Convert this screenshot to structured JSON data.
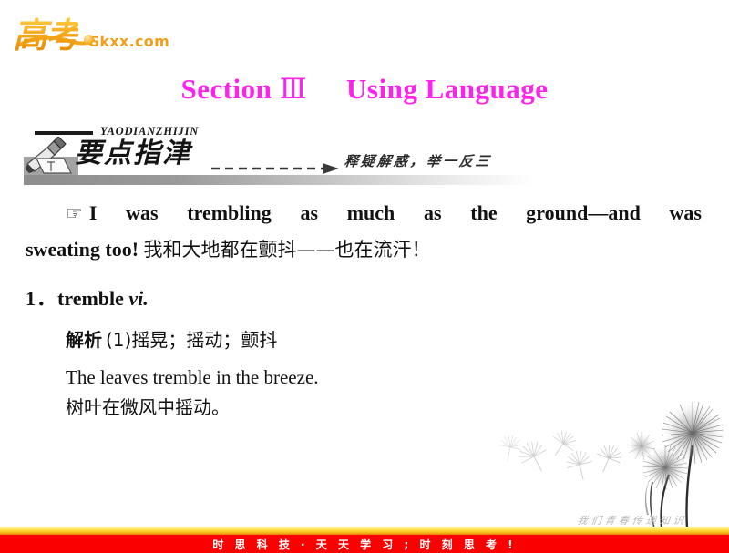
{
  "logo": {
    "cn": "高考",
    "site": "Gkxx.com",
    "color": "#f0a01a"
  },
  "title": {
    "prefix": "Section",
    "roman": "Ⅲ",
    "suffix": "Using Language",
    "color": "#ff22ee"
  },
  "banner": {
    "pinyin": "YAODIANZHIJIN",
    "heading": "要点指津",
    "tagline": "释疑解惑，举一反三",
    "icon": "pen-ink-icon"
  },
  "content": {
    "hand_icon": "☞",
    "quote_en_line1": "I was trembling as much as the ground—and was",
    "quote_en_line2": "sweating too!",
    "quote_cn": "我和大地都在颤抖——也在流汗！",
    "entry_number": "1．",
    "entry_word": "tremble",
    "entry_pos": "vi.",
    "explain_label": "解析",
    "explain_gloss": "(1)摇晃；摇动；颤抖",
    "example_en": "The leaves tremble in the breeze.",
    "example_cn": "树叶在微风中摇动。"
  },
  "artwork": {
    "calligraphy": "我们青春传递知识",
    "name": "dandelion-illustration"
  },
  "footer": {
    "text": "时 思 科 技 · 天 天 学 习 ; 时 刻 思 考 !",
    "bar_color": "#fb0000"
  }
}
